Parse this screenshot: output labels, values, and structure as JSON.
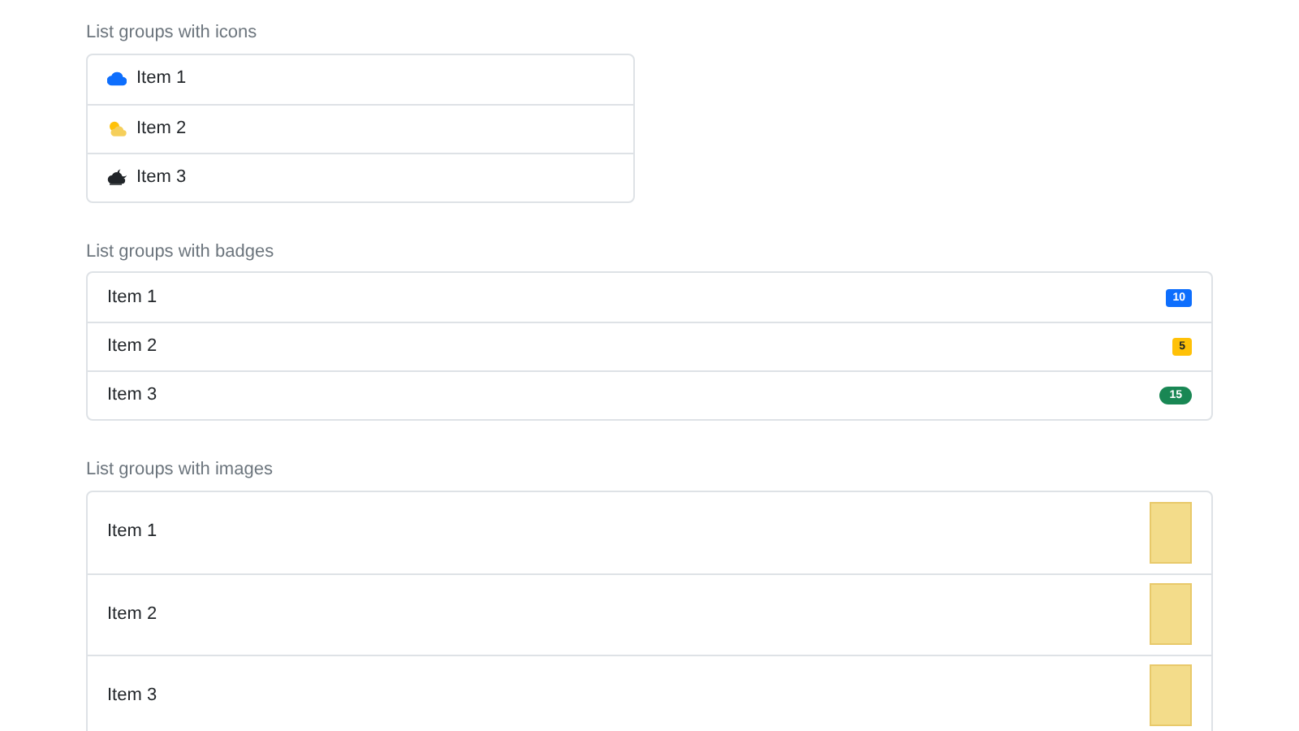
{
  "sections": [
    {
      "kind": "icons",
      "title": "List groups with icons",
      "items": [
        {
          "label": "Item 1",
          "kind": "cloud"
        },
        {
          "label": "Item 2",
          "kind": "sun-cloud"
        },
        {
          "label": "Item 3",
          "kind": "moon-cloud"
        }
      ]
    },
    {
      "kind": "badges",
      "title": "List groups with badges",
      "items": [
        {
          "label": "Item 1",
          "badge": "10",
          "color": "#0d6efd",
          "kind": "square"
        },
        {
          "label": "Item 2",
          "badge": "5",
          "color": "#ffc107",
          "kind": "square"
        },
        {
          "label": "Item 3",
          "badge": "15",
          "color": "#198754",
          "kind": "pill"
        }
      ]
    },
    {
      "kind": "images",
      "title": "List groups with images",
      "items": [
        {
          "label": "Item 1"
        },
        {
          "label": "Item 2"
        },
        {
          "label": "Item 3"
        }
      ]
    }
  ]
}
